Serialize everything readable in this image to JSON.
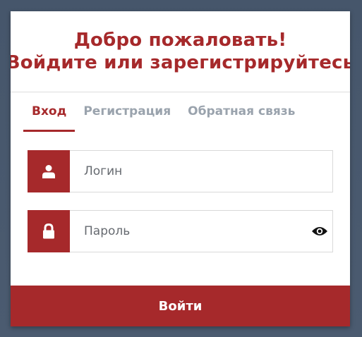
{
  "header": {
    "title_line1": "Добро пожаловать!",
    "title_line2": "Войдите или зарегистрируйтесь"
  },
  "tabs": [
    {
      "label": "Вход",
      "active": true
    },
    {
      "label": "Регистрация",
      "active": false
    },
    {
      "label": "Обратная связь",
      "active": false
    }
  ],
  "form": {
    "login": {
      "placeholder": "Логин",
      "value": "",
      "icon": "user-icon"
    },
    "password": {
      "placeholder": "Пароль",
      "value": "",
      "icon": "lock-icon",
      "toggle_icon": "eye-icon"
    }
  },
  "submit": {
    "label": "Войти"
  },
  "colors": {
    "accent": "#a6292b",
    "background": "#4a5a6e",
    "tab_inactive": "#9aa3ad"
  }
}
